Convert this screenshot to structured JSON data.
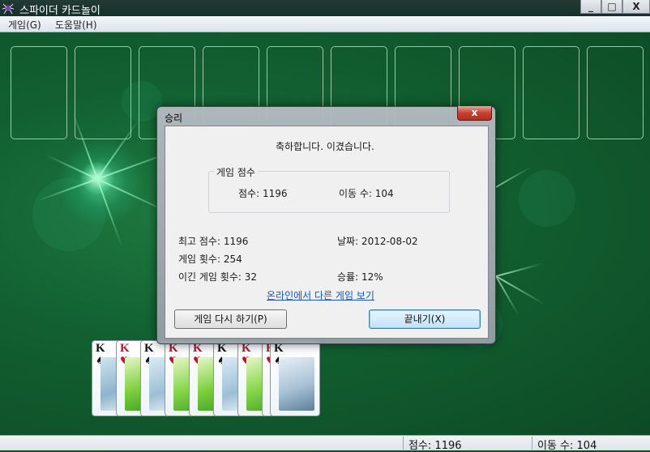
{
  "window": {
    "title": "스파이더 카드놀이",
    "controls": {
      "minimize": "_",
      "maximize": "□",
      "close": "X"
    }
  },
  "menu": {
    "items": [
      {
        "label": "게임(G)"
      },
      {
        "label": "도움말(H)"
      }
    ]
  },
  "dialog": {
    "title": "승리",
    "close_label": "x",
    "congrats": "축하합니다. 이겼습니다.",
    "game_score": {
      "legend": "게임 점수",
      "score": "점수: 1196",
      "moves": "이동 수: 104"
    },
    "stats": {
      "best_score": "최고 점수: 1196",
      "date": "날짜: 2012-08-02",
      "games_played": "게임 횟수: 254",
      "games_won": "이긴 게임 횟수: 32",
      "win_rate": "승률: 12%"
    },
    "online_link": "온라인에서 다른 게임 보기",
    "play_again_button": "게임 다시 하기(P)",
    "exit_button": "끝내기(X)"
  },
  "completed_stack": {
    "ranks": [
      "K",
      "K",
      "K",
      "K",
      "K",
      "K",
      "K",
      "K",
      "K"
    ],
    "suits": [
      "♠",
      "♥",
      "♠",
      "♥",
      "♥",
      "♠",
      "♥",
      "♥",
      "♠"
    ]
  },
  "status": {
    "score": "점수: 1196",
    "moves": "이동 수:  104"
  },
  "colors": {
    "felt": "#126132",
    "accent_red": "#c8102e",
    "link": "#1a54c8"
  }
}
